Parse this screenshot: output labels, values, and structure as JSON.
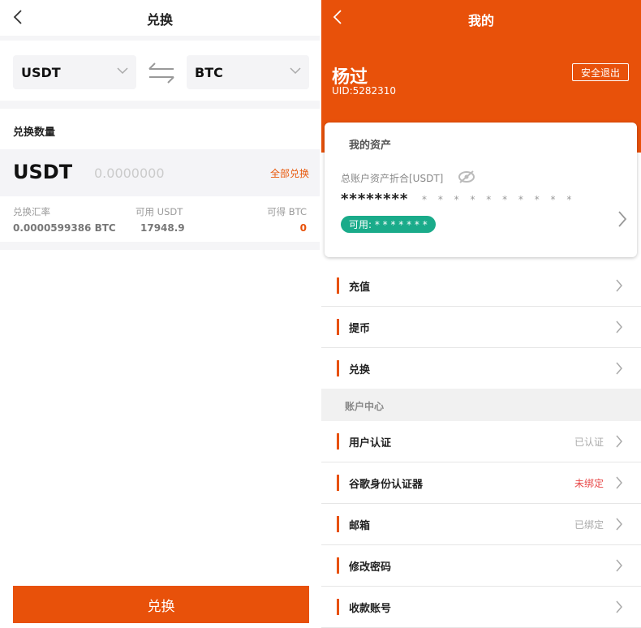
{
  "exchange": {
    "title": "兑换",
    "from_coin": "USDT",
    "to_coin": "BTC",
    "amount_title": "兑换数量",
    "amount_coin": "USDT",
    "amount_placeholder": "0.0000000",
    "all_label": "全部兑换",
    "rate_label": "兑换汇率",
    "rate_value": "0.0000599386 BTC",
    "available_label": "可用 USDT",
    "available_value": "17948.9",
    "receive_label": "可得 BTC",
    "receive_value": "0",
    "submit_label": "兑换"
  },
  "profile": {
    "title": "我的",
    "user_name": "杨过",
    "uid": "UID:5282310",
    "logout_label": "安全退出",
    "assets": {
      "title": "我的资产",
      "subtitle": "总账户资产折合[USDT]",
      "masked_total": "********",
      "masked_secondary": "* * * * * * * * * *",
      "available_badge": "可用: * * * * * * *"
    },
    "menu_top": [
      {
        "label": "充值"
      },
      {
        "label": "提币"
      },
      {
        "label": "兑换"
      }
    ],
    "section_title": "账户中心",
    "menu_account": [
      {
        "label": "用户认证",
        "status": "已认证"
      },
      {
        "label": "谷歌身份认证器",
        "status": "未绑定"
      },
      {
        "label": "邮箱",
        "status": "已绑定"
      },
      {
        "label": "修改密码",
        "status": ""
      },
      {
        "label": "收款账号",
        "status": ""
      }
    ]
  },
  "colors": {
    "brand": "#e8510a",
    "available_badge": "#1aab8a",
    "unbound_status": "#e84a4a"
  }
}
